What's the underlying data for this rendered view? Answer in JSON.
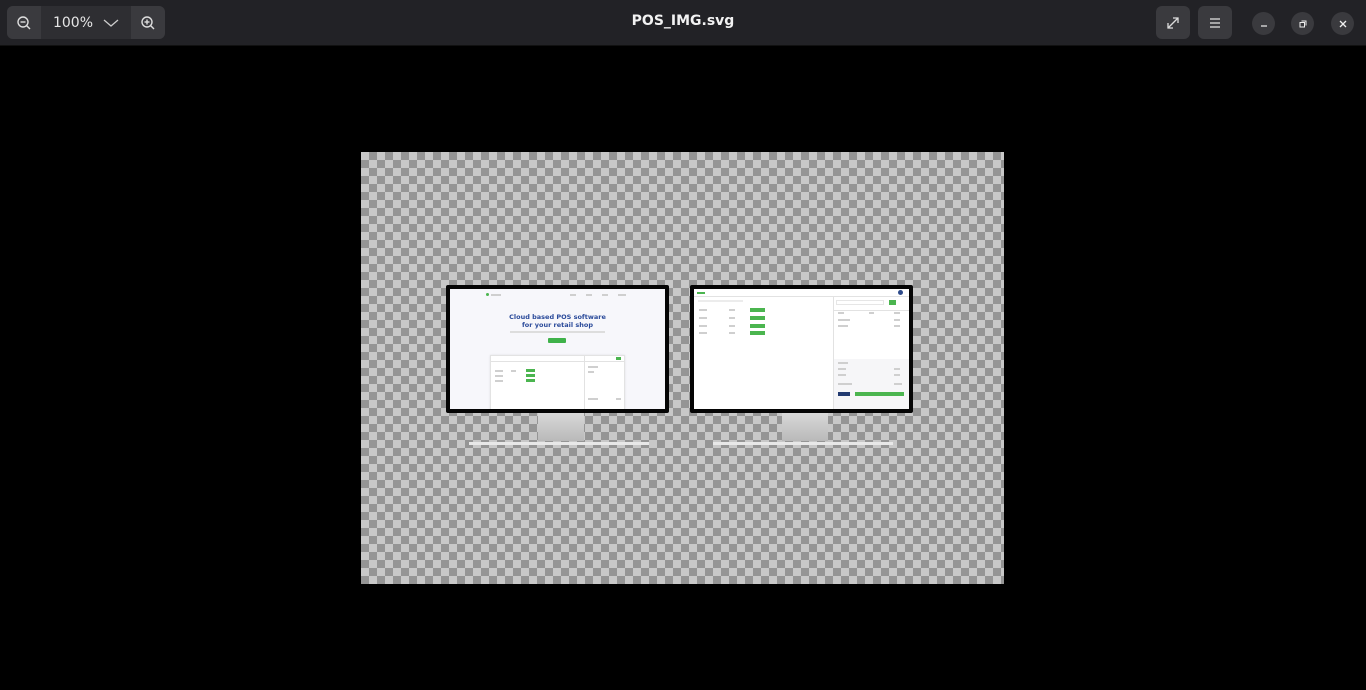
{
  "toolbar": {
    "zoom_level": "100%",
    "zoom_out_icon": "zoom-out-icon",
    "zoom_in_icon": "zoom-in-icon",
    "dropdown_icon": "chevron-down-icon"
  },
  "window": {
    "title": "POS_IMG.svg",
    "fullscreen_icon": "fullscreen-icon",
    "menu_icon": "hamburger-menu-icon",
    "minimize_icon": "minimize-icon",
    "restore_icon": "restore-icon",
    "close_icon": "close-icon"
  },
  "image": {
    "left_screen": {
      "hero_title_line1": "Cloud based POS software",
      "hero_title_line2": "for your retail shop"
    }
  },
  "colors": {
    "accent_green": "#4bb54f",
    "hero_blue": "#2a4a9a",
    "titlebar": "#222226"
  }
}
